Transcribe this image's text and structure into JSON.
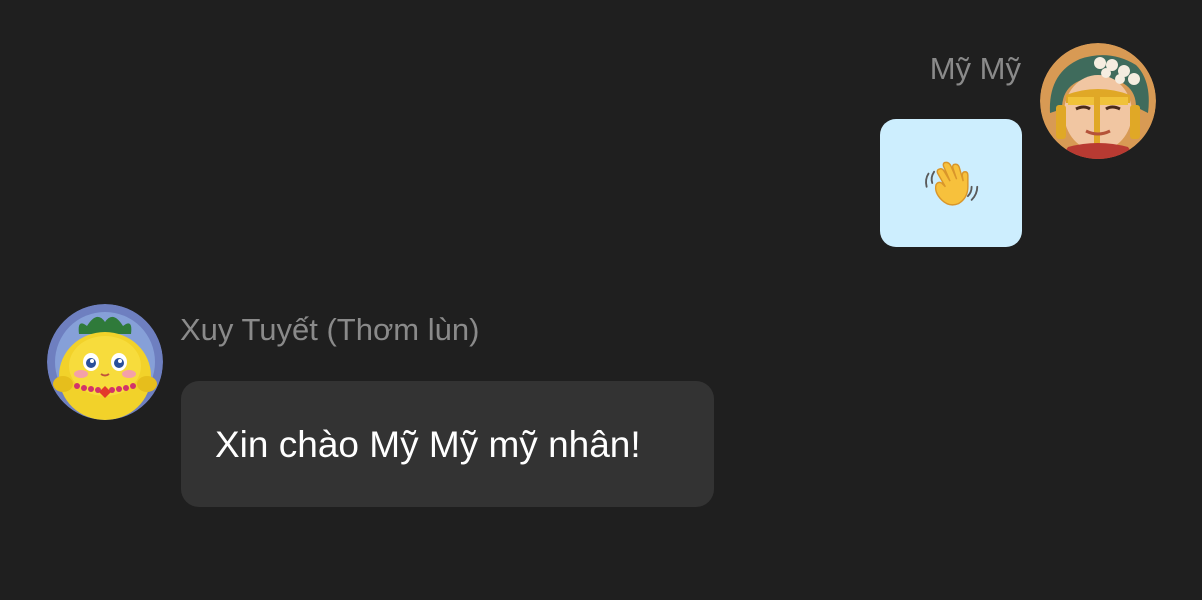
{
  "messages": [
    {
      "side": "right",
      "sender": "Mỹ Mỹ",
      "avatar": "female-character-avatar",
      "content_type": "emoji",
      "emoji": "waving-hand-icon",
      "bubble_color": "#cdeefe"
    },
    {
      "side": "left",
      "sender": "Xuy Tuyết (Thơm lùn)",
      "avatar": "yellow-character-avatar",
      "content_type": "text",
      "text": "Xin chào Mỹ Mỹ mỹ nhân!",
      "bubble_color": "#333333"
    }
  ],
  "theme": {
    "background": "#1f1f1f",
    "name_color": "#8a8a8a",
    "text_color": "#ffffff"
  }
}
